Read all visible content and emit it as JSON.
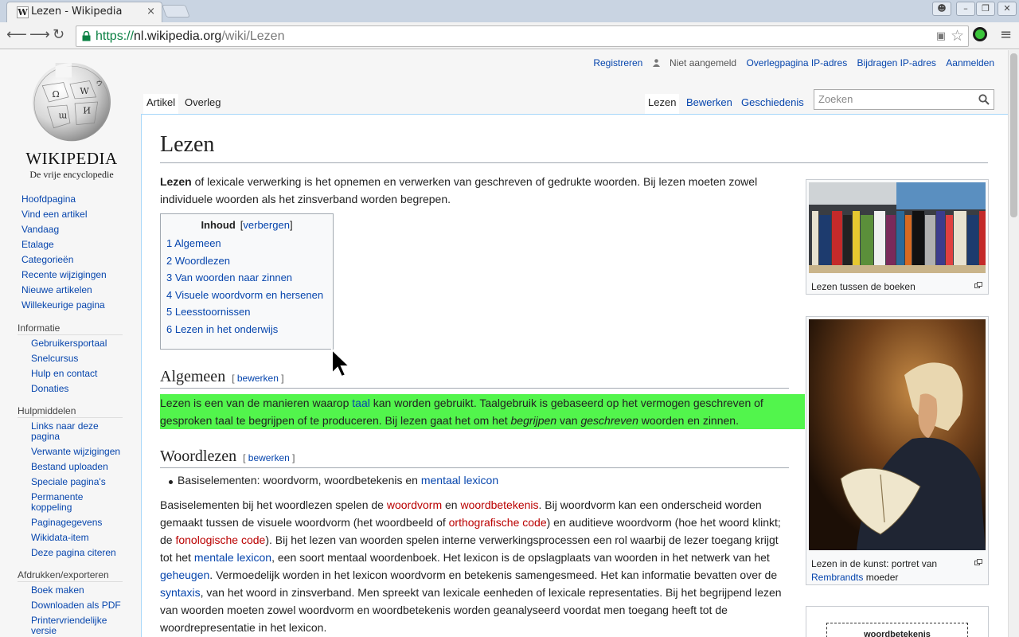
{
  "browser": {
    "tab_title": "Lezen - Wikipedia",
    "tab_favicon": "W",
    "close": "×",
    "url_scheme": "https://",
    "url_host": "nl.wikipedia.org",
    "url_path": "/wiki/Lezen"
  },
  "personal": {
    "register": "Registreren",
    "not_logged_in": "Niet aangemeld",
    "talk": "Overlegpagina IP-adres",
    "contribs": "Bijdragen IP-adres",
    "login": "Aanmelden"
  },
  "logo": {
    "wordmark": "WIKIPEDIA",
    "tagline": "De vrije encyclopedie"
  },
  "sidebar": {
    "nav": [
      "Hoofdpagina",
      "Vind een artikel",
      "Vandaag",
      "Etalage",
      "Categorieën",
      "Recente wijzigingen",
      "Nieuwe artikelen",
      "Willekeurige pagina"
    ],
    "info_heading": "Informatie",
    "info": [
      "Gebruikersportaal",
      "Snelcursus",
      "Hulp en contact",
      "Donaties"
    ],
    "tools_heading": "Hulpmiddelen",
    "tools": [
      "Links naar deze pagina",
      "Verwante wijzigingen",
      "Bestand uploaden",
      "Speciale pagina's",
      "Permanente koppeling",
      "Paginagegevens",
      "Wikidata-item",
      "Deze pagina citeren"
    ],
    "print_heading": "Afdrukken/exporteren",
    "print": [
      "Boek maken",
      "Downloaden als PDF",
      "Printervriendelijke versie"
    ]
  },
  "tabs": {
    "article": "Artikel",
    "talk": "Overleg",
    "read": "Lezen",
    "edit": "Bewerken",
    "history": "Geschiedenis"
  },
  "search": {
    "placeholder": "Zoeken"
  },
  "article": {
    "title": "Lezen",
    "intro_bold": "Lezen",
    "intro": " of lexicale verwerking is het opnemen en verwerken van geschreven of gedrukte woorden. Bij lezen moeten zowel individuele woorden als het zinsverband worden begrepen.",
    "toc": {
      "heading": "Inhoud",
      "toggle": "verbergen",
      "items": [
        "1 Algemeen",
        "2 Woordlezen",
        "3 Van woorden naar zinnen",
        "4 Visuele woordvorm en hersenen",
        "5 Leesstoornissen",
        "6 Lezen in het onderwijs"
      ]
    },
    "edit_label": "bewerken",
    "sec1_title": "Algemeen",
    "sec1": {
      "a": "Lezen is een van de manieren waarop ",
      "link": "taal",
      "b": " kan worden gebruikt. Taalgebruik is gebaseerd op het vermogen geschreven of gesproken taal te begrijpen of te produceren. Bij lezen gaat het om het ",
      "i1": "begrijpen",
      "c": " van ",
      "i2": "geschreven",
      "d": " woorden en zinnen."
    },
    "sec2_title": "Woordlezen",
    "bullet": {
      "text": "Basiselementen: woordvorm, woordbetekenis en ",
      "link": "mentaal lexicon"
    },
    "p2": {
      "t1": "Basiselementen bij het woordlezen spelen de ",
      "l1": "woordvorm",
      "t2": " en ",
      "l2": "woordbetekenis",
      "t3": ". Bij woordvorm kan een onderscheid worden gemaakt tussen de visuele woordvorm (het woordbeeld of ",
      "l3": "orthografische code",
      "t4": ") en auditieve woordvorm (hoe het woord klinkt; de ",
      "l4": "fonologische code",
      "t5": "). Bij het lezen van woorden spelen interne verwerkingsprocessen een rol waarbij de lezer toegang krijgt tot het ",
      "l5": "mentale lexicon",
      "t6": ", een soort mentaal woordenboek. Het lexicon is de opslagplaats van woorden in het netwerk van het ",
      "l6": "geheugen",
      "t7": ". Vermoedelijk worden in het lexicon woordvorm en betekenis samengesmeed. Het kan informatie bevatten over de ",
      "l7": "syntaxis",
      "t8": ", van het woord in zinsverband. Men spreekt van lexicale eenheden of lexicale representaties. Bij het begrijpend lezen van woorden moeten zowel woordvorm en woordbetekenis worden geanalyseerd voordat men toegang heeft tot de woordrepresentatie in het lexicon."
    }
  },
  "figures": {
    "fig1_caption": "Lezen tussen de boeken",
    "fig2_caption_a": "Lezen in de kunst: portret van ",
    "fig2_link": "Rembrandts",
    "fig2_caption_b": " moeder",
    "fig3_label": "woordbetekenis"
  },
  "colors": {
    "link": "#0645ad",
    "redlink": "#ba0000",
    "highlight": "#52f54c",
    "border": "#a7d7f9"
  }
}
